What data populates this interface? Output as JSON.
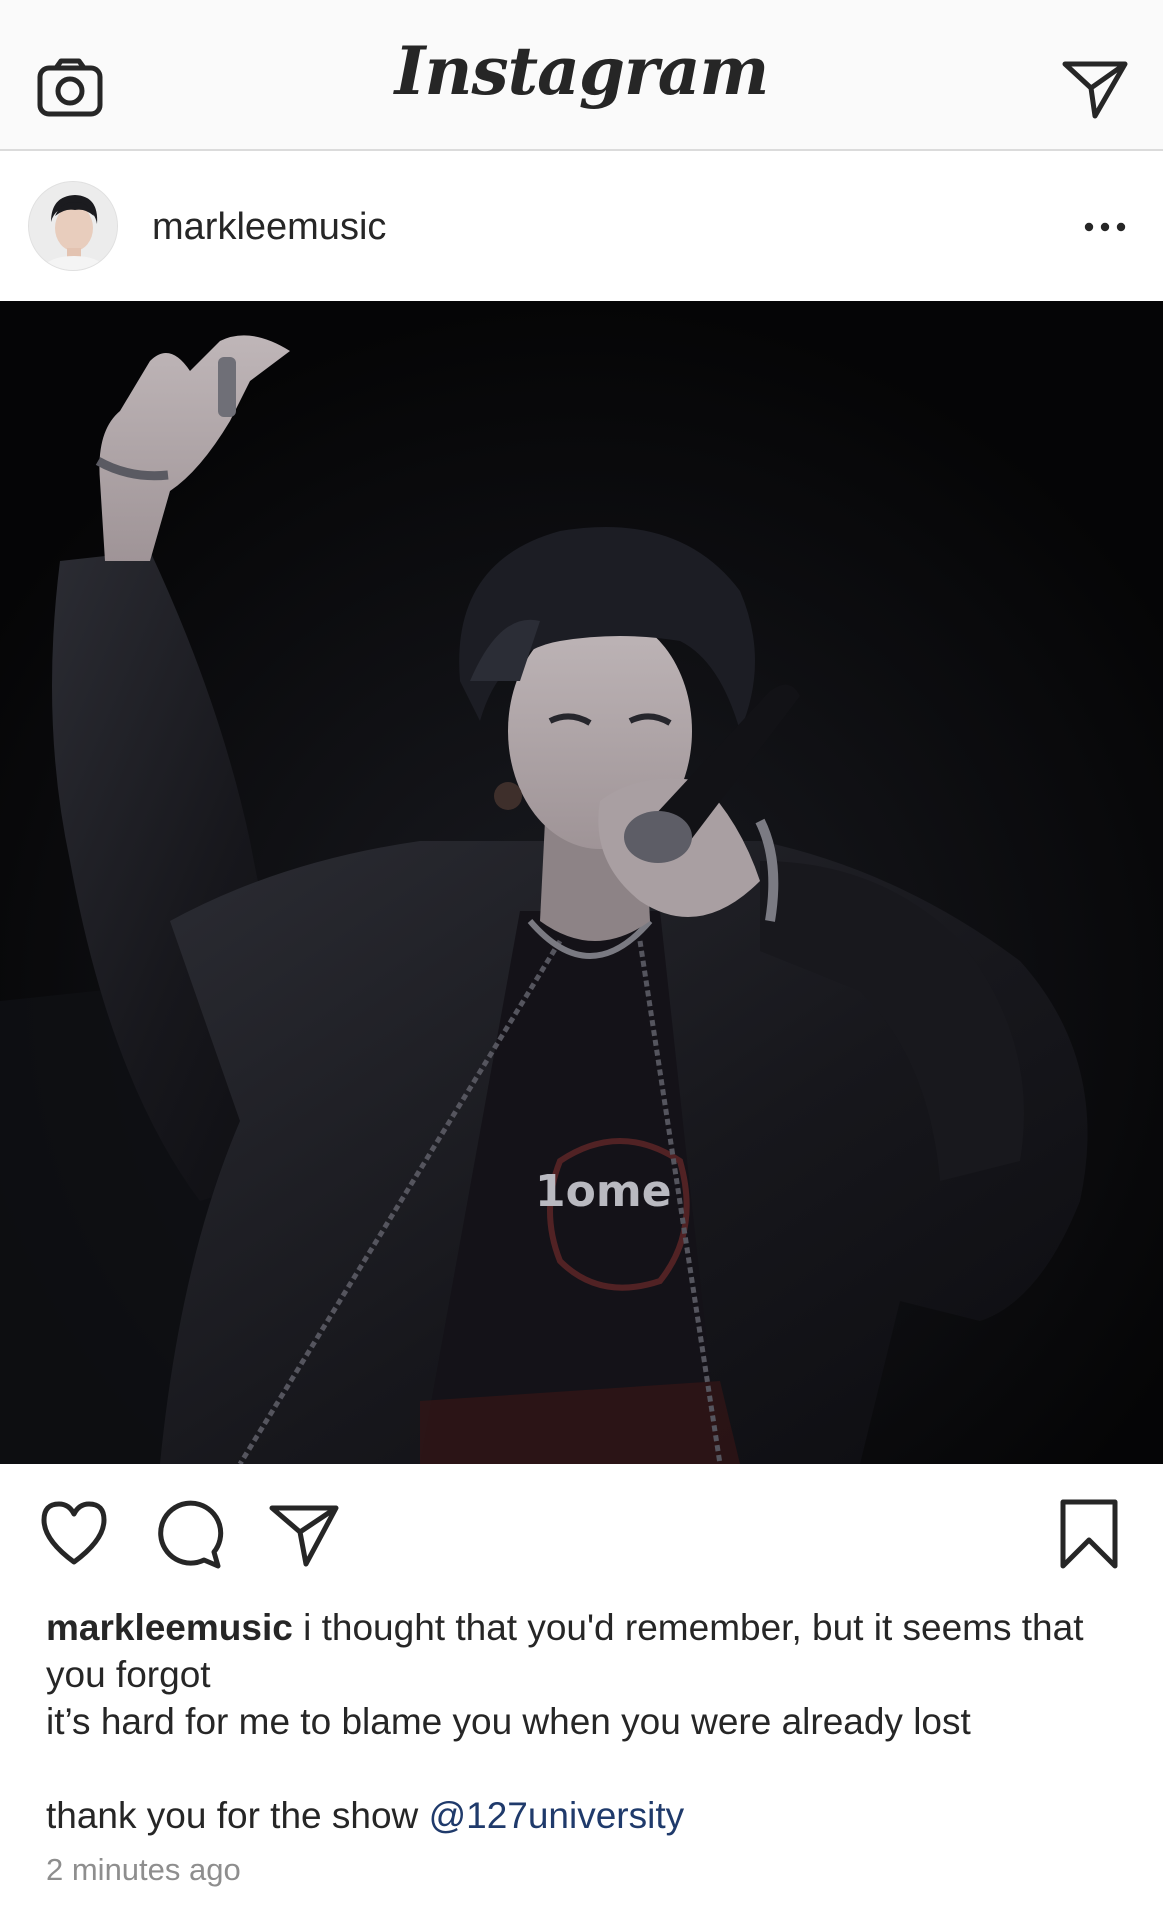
{
  "app": {
    "logo_text": "Instagram"
  },
  "header": {
    "camera_icon": "camera-icon",
    "direct_icon": "paper-plane-icon"
  },
  "post": {
    "username": "markleemusic",
    "more_icon": "ellipsis-icon",
    "photo_description_icon": "concert-photo",
    "actions": {
      "like_icon": "heart-icon",
      "comment_icon": "comment-bubble-icon",
      "share_icon": "paper-plane-icon",
      "save_icon": "bookmark-icon"
    },
    "caption": {
      "username": "markleemusic",
      "first_line": " i thought that you'd remember, but it seems that you forgot",
      "second_line": "it’s hard for me to blame you when you were already lost",
      "third_line_prefix": "thank you for the show ",
      "mention": "@127university"
    },
    "timestamp": "2 minutes ago"
  },
  "colors": {
    "background": "#ffffff",
    "topbar_bg": "#fafafa",
    "text": "#262626",
    "muted": "#8e8e8e",
    "mention": "#1f3a6b"
  }
}
